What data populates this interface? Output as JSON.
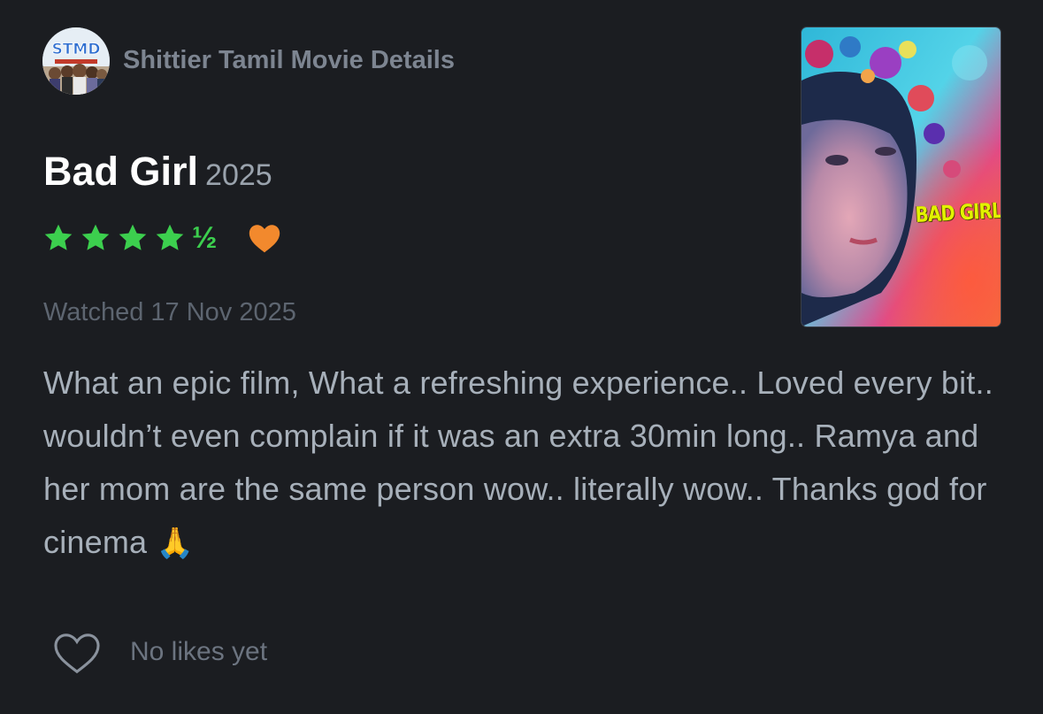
{
  "author": {
    "name": "Shittier Tamil Movie Details",
    "avatar_text": "STMD"
  },
  "film": {
    "title": "Bad Girl",
    "year": "2025"
  },
  "rating": {
    "stars": 4.5,
    "half_glyph": "½",
    "liked": true,
    "star_color": "#3ccf4e",
    "heart_color": "#f2892d"
  },
  "watched": "Watched 17 Nov 2025",
  "review": {
    "text": "What an epic film, What a refreshing experience.. Loved every bit.. wouldn’t even complain if it was an extra 30min long..  Ramya and her mom are the same person wow.. literally wow.. Thanks god for cinema",
    "emoji": "🙏"
  },
  "poster": {
    "title_text": "BAD GIRL"
  },
  "likes": {
    "text": "No likes yet",
    "icon": "heart-outline-icon"
  }
}
